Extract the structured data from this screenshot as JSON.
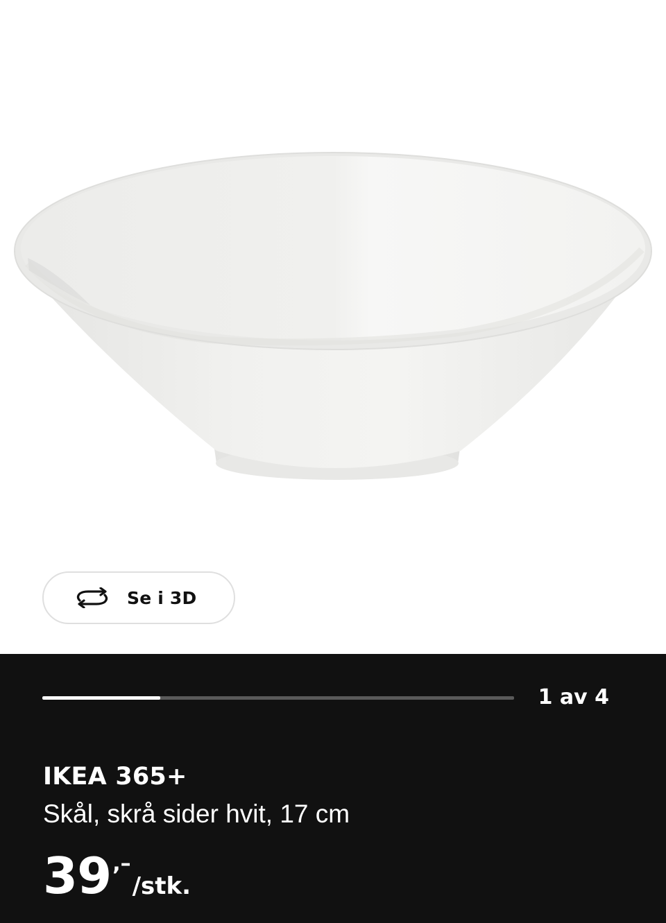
{
  "gallery": {
    "view_3d_label": "Se i 3D",
    "view_3d_icon": "rotate-3d-icon",
    "image_subject": "white-bowl",
    "progress": {
      "current": 1,
      "total": 4,
      "fraction": 0.25
    },
    "counter_text": "1 av 4"
  },
  "product": {
    "brand": "IKEA 365+",
    "description": "Skål, skrå sider hvit, 17 cm",
    "price_main": "39",
    "price_decimals": ",–",
    "price_unit": "/stk."
  },
  "colors": {
    "panel_bg": "#111111",
    "text": "#ffffff",
    "progress_track": "#5a5a5a",
    "progress_fill": "#ffffff",
    "button_border": "#dfdfdf"
  }
}
